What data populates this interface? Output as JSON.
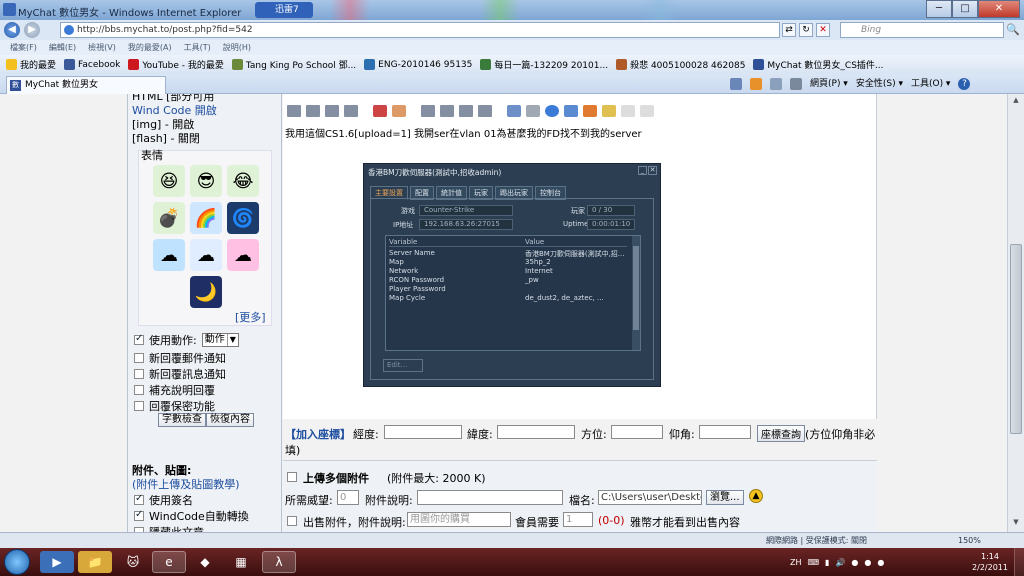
{
  "window": {
    "title": "MyChat 數位男女 - Windows Internet Explorer",
    "notification": "迅雷7",
    "min": "─",
    "max": "□",
    "close": "✕"
  },
  "address": {
    "url": "http://bbs.mychat.to/post.php?fid=542",
    "search_placeholder": "Bing",
    "search_icon": "🔍",
    "compat_icon": "⇄",
    "refresh_icon": "↻",
    "stop_icon": "✕"
  },
  "menu": [
    "檔案(F)",
    "編輯(E)",
    "檢視(V)",
    "我的最愛(A)",
    "工具(T)",
    "說明(H)"
  ],
  "favorites": {
    "label": "我的最愛",
    "items": [
      {
        "label": "Facebook",
        "color": "#3b5998"
      },
      {
        "label": "YouTube - 我的最愛",
        "color": "#cc181e"
      },
      {
        "label": "Tang King Po School 鄧...",
        "color": "#6a8a3a"
      },
      {
        "label": "ENG-2010146 95135",
        "color": "#2b6fb0"
      },
      {
        "label": "每日一篇-132209 20101...",
        "color": "#3a7a3a"
      },
      {
        "label": "殺悲 4005100028 462085",
        "color": "#b05a2a"
      },
      {
        "label": "MyChat 數位男女_CS插件...",
        "color": "#2f4f98"
      }
    ]
  },
  "tab": {
    "label": "MyChat 數位男女",
    "icon_text": "數"
  },
  "commands": [
    "網頁(P) ▾",
    "安全性(S) ▾",
    "工具(O) ▾",
    "?"
  ],
  "sidebar": {
    "html_line": "HTML [部分可用",
    "windcode": "Wind Code 開啟",
    "img": "[img] - 開啟",
    "flash": "[flash] - 關閉",
    "emoticons_title": "表情",
    "more": "[更多]",
    "use_action": "使用動作:",
    "action_select": "動作",
    "options": [
      "新回覆郵件通知",
      "新回覆訊息通知",
      "補充說明回覆",
      "回覆保密功能"
    ],
    "btn_count": "字數檢查",
    "btn_restore": "恢復內容",
    "attach_title": "附件、貼圖:",
    "attach_link": "(附件上傳及貼圖教學)",
    "use_signature": "使用簽名",
    "windcode_convert": "WindCode自動轉換",
    "hide_article": "隱藏此文章"
  },
  "editor": {
    "post_text": "我用這個CS1.6[upload=1] 我開ser在vlan 01為甚麼我的FD找不到我的server"
  },
  "server_window": {
    "title": "香港BM刀歡伺服器(測試中,招收admin)",
    "tabs": [
      "主要設置",
      "配置",
      "統計值",
      "玩家",
      "踢出玩家",
      "控制台"
    ],
    "game_label": "游戏",
    "game_value": "Counter-Strike",
    "players_label": "玩家",
    "players_value": "0 / 30",
    "ip_label": "IP地址",
    "ip_value": "192.168.63.26:27015",
    "uptime_label": "Uptime",
    "uptime_value": "0:00:01:10",
    "col_variable": "Variable",
    "col_value": "Value",
    "rows": [
      {
        "k": "Server Name",
        "v": "香港BM刀歡伺服器(測試中,招..."
      },
      {
        "k": "Map",
        "v": "35hp_2"
      },
      {
        "k": "Network",
        "v": "Internet"
      },
      {
        "k": "RCON Password",
        "v": "_pw"
      },
      {
        "k": "Player Password",
        "v": ""
      },
      {
        "k": "Map Cycle",
        "v": "de_dust2, de_aztec, ..."
      }
    ],
    "edit_button": "Edit..."
  },
  "coords": {
    "add_label": "【加入座標】",
    "longitude": "經度:",
    "latitude": "緯度:",
    "bearing": "方位:",
    "elevation": "仰角:",
    "query_btn": "座標查詢",
    "note": "(方位仰角非必",
    "note2": "填)"
  },
  "attachments": {
    "multi_label": "上傳多個附件",
    "max_label": "(附件最大: 2000 K)",
    "required_label": "所需威望:",
    "required_value": "0",
    "desc_label": "附件說明:",
    "filename_label": "檔名:",
    "filename_value": "C:\\Users\\user\\Desktop\\c",
    "browse_btn": "瀏覽...",
    "sell_label": "出售附件，附件說明:",
    "sell_placeholder": "用圖你的購買",
    "member_label": "會員需要",
    "member_value": "1",
    "range": "(0-0)",
    "sell_note": "雅幣才能看到出售內容"
  },
  "status": {
    "zone": "網際網路 | 受保護模式: 關閉",
    "zoom": "150%"
  },
  "taskbar": {
    "lang": "ZH",
    "time": "1:14",
    "date": "2/2/2011"
  }
}
